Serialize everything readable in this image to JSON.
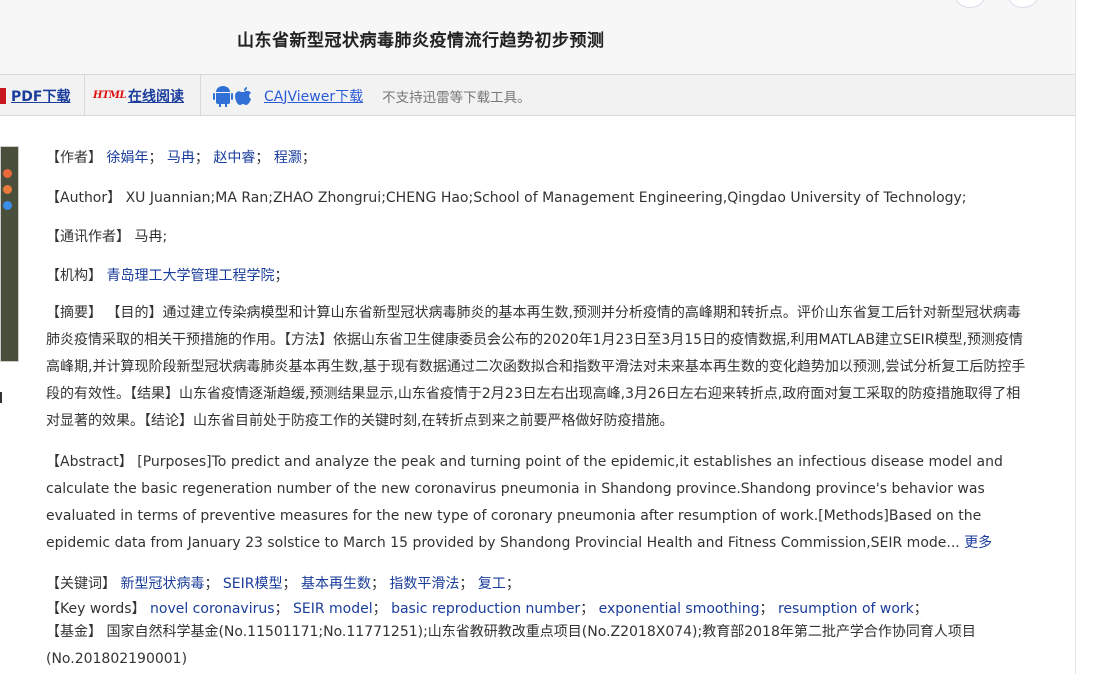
{
  "header": {
    "title": "山东省新型冠状病毒肺炎疫情流行趋势初步预测"
  },
  "toolbar": {
    "pdf_label": "PDF下载",
    "html_badge": "HTML",
    "html_label": "在线阅读",
    "caj_label": "CAJViewer下载",
    "note": "不支持迅雷等下载工具。"
  },
  "meta": {
    "authors_label": "【作者】",
    "authors": [
      "徐娟年",
      "马冉",
      "赵中睿",
      "程灏"
    ],
    "author_en_label": "【Author】",
    "author_en": "XU Juannian;MA Ran;ZHAO Zhongrui;CHENG Hao;School of Management Engineering,Qingdao University of Technology;",
    "corresponding_label": "【通讯作者】",
    "corresponding": "马冉;",
    "institution_label": "【机构】",
    "institution": "青岛理工大学管理工程学院",
    "abstract_label": "【摘要】",
    "abstract": "【目的】通过建立传染病模型和计算山东省新型冠状病毒肺炎的基本再生数,预测并分析疫情的高峰期和转折点。评价山东省复工后针对新型冠状病毒肺炎疫情采取的相关干预措施的作用。【方法】依据山东省卫生健康委员会公布的2020年1月23日至3月15日的疫情数据,利用MATLAB建立SEIR模型,预测疫情高峰期,并计算现阶段新型冠状病毒肺炎基本再生数,基于现有数据通过二次函数拟合和指数平滑法对未来基本再生数的变化趋势加以预测,尝试分析复工后防控手段的有效性。【结果】山东省疫情逐渐趋缓,预测结果显示,山东省疫情于2月23日左右出现高峰,3月26日左右迎来转折点,政府面对复工采取的防疫措施取得了相对显著的效果。【结论】山东省目前处于防疫工作的关键时刻,在转折点到来之前要严格做好防疫措施。",
    "abstract_en_label": "【Abstract】",
    "abstract_en": "[Purposes]To predict and analyze the peak and turning point of the epidemic,it establishes an infectious disease model and calculate the basic regeneration number of the new coronavirus pneumonia in Shandong province.Shandong province's behavior was evaluated in terms of preventive measures for the new type of coronary pneumonia after resumption of work.[Methods]Based on the epidemic data from January 23 solstice to March 15 provided by Shandong Provincial Health and Fitness Commission,SEIR mode...",
    "more_label": "更多",
    "keywords_label": "【关键词】",
    "keywords": [
      "新型冠状病毒",
      "SEIR模型",
      "基本再生数",
      "指数平滑法",
      "复工"
    ],
    "keywords_en_label": "【Key words】",
    "keywords_en": [
      "novel coronavirus",
      "SEIR model",
      "basic reproduction number",
      "exponential smoothing",
      "resumption of work"
    ],
    "fund_label": "【基金】",
    "fund": "国家自然科学基金(No.11501171;No.11771251);山东省教研教改重点项目(No.Z2018X074);教育部2018年第二批产学合作协同育人项目(No.201802190001)"
  },
  "colors": {
    "link": "#1a3d9c",
    "pdf_red": "#c8181e",
    "toolbar_bg": "#f2f2f2"
  }
}
